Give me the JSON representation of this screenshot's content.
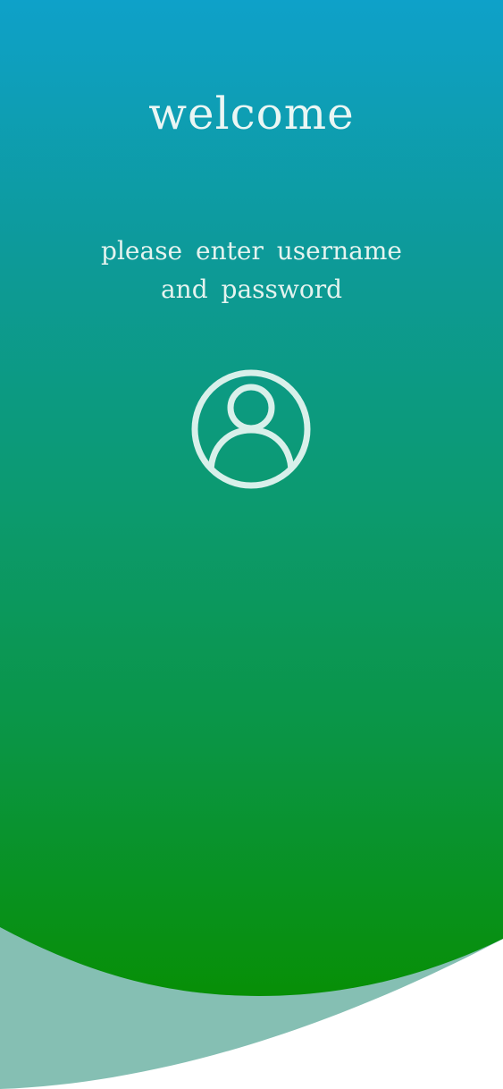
{
  "header": {
    "title": "welcome",
    "subtitle_line1": "please enter username",
    "subtitle_line2": "and password"
  },
  "icons": {
    "avatar": "user-circle-icon"
  },
  "colors": {
    "gradient_top": "#0ea1c9",
    "gradient_mid": "#0c9a7e",
    "gradient_bottom": "#098f0a",
    "wave_light": "#85bfb3",
    "text": "#eaf6f4",
    "icon": "#d8f0ea"
  }
}
